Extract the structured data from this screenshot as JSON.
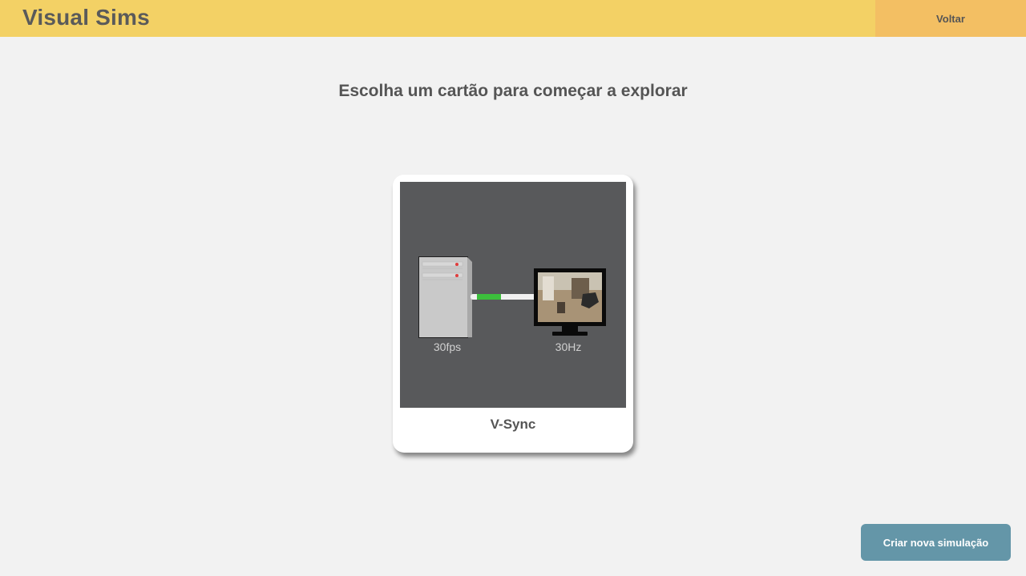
{
  "header": {
    "brand": "Visual Sims",
    "back_label": "Voltar"
  },
  "main": {
    "title": "Escolha um cartão para começar a explorar",
    "cards": [
      {
        "label": "V-Sync",
        "thumb": {
          "left_caption": "30fps",
          "right_caption": "30Hz"
        }
      }
    ]
  },
  "footer": {
    "new_sim_label": "Criar nova simulação"
  },
  "colors": {
    "header_bg": "#f3d165",
    "back_bg": "#f3bf63",
    "page_bg": "#f2f2f2",
    "thumb_bg": "#58595b",
    "button_bg": "#6496a8",
    "cable_green": "#3cbf3c"
  }
}
